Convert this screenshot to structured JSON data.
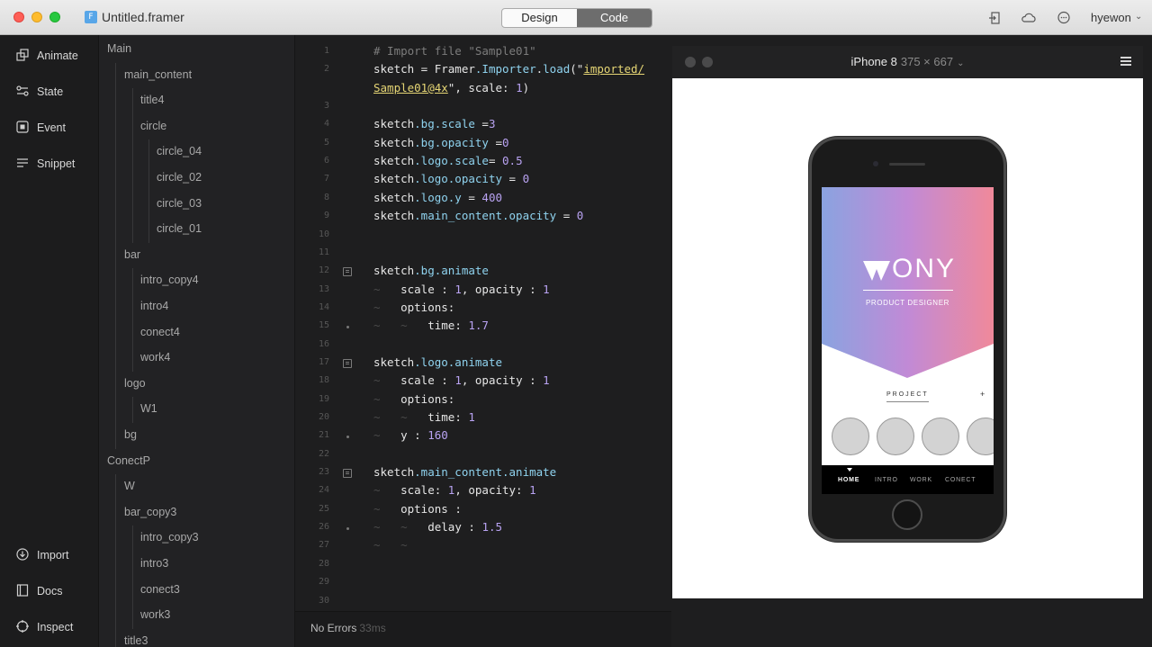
{
  "window": {
    "title": "Untitled.framer",
    "doc_icon": "F",
    "mode_tabs": [
      {
        "label": "Design",
        "active": false
      },
      {
        "label": "Code",
        "active": true
      }
    ],
    "toolbar_icons": [
      "export-icon",
      "cloud-icon",
      "chat-icon"
    ],
    "user": "hyewon"
  },
  "leftnav": {
    "top": [
      {
        "icon": "animate-icon",
        "label": "Animate"
      },
      {
        "icon": "state-icon",
        "label": "State"
      },
      {
        "icon": "event-icon",
        "label": "Event"
      },
      {
        "icon": "snippet-icon",
        "label": "Snippet"
      }
    ],
    "bottom": [
      {
        "icon": "import-icon",
        "label": "Import"
      },
      {
        "icon": "docs-icon",
        "label": "Docs"
      },
      {
        "icon": "inspect-icon",
        "label": "Inspect"
      }
    ]
  },
  "layers": [
    {
      "name": "Main",
      "depth": 0
    },
    {
      "name": "main_content",
      "depth": 1
    },
    {
      "name": "title4",
      "depth": 2
    },
    {
      "name": "circle",
      "depth": 2
    },
    {
      "name": "circle_04",
      "depth": 3
    },
    {
      "name": "circle_02",
      "depth": 3
    },
    {
      "name": "circle_03",
      "depth": 3
    },
    {
      "name": "circle_01",
      "depth": 3
    },
    {
      "name": "bar",
      "depth": 1
    },
    {
      "name": "intro_copy4",
      "depth": 2
    },
    {
      "name": "intro4",
      "depth": 2
    },
    {
      "name": "conect4",
      "depth": 2
    },
    {
      "name": "work4",
      "depth": 2
    },
    {
      "name": "logo",
      "depth": 1
    },
    {
      "name": "W1",
      "depth": 2
    },
    {
      "name": "bg",
      "depth": 1
    },
    {
      "name": "ConectP",
      "depth": 0
    },
    {
      "name": "W",
      "depth": 1
    },
    {
      "name": "bar_copy3",
      "depth": 1
    },
    {
      "name": "intro_copy3",
      "depth": 2
    },
    {
      "name": "intro3",
      "depth": 2
    },
    {
      "name": "conect3",
      "depth": 2
    },
    {
      "name": "work3",
      "depth": 2
    },
    {
      "name": "title3",
      "depth": 1
    }
  ],
  "code": {
    "line_numbers": [
      "1",
      "2",
      "",
      "3",
      "4",
      "5",
      "6",
      "7",
      "8",
      "9",
      "10",
      "11",
      "12",
      "13",
      "14",
      "15",
      "16",
      "17",
      "18",
      "19",
      "20",
      "21",
      "22",
      "23",
      "24",
      "25",
      "26",
      "27",
      "28",
      "29",
      "30"
    ],
    "lines": [
      {
        "n": "1",
        "tokens": [
          [
            "c-comment",
            "# Import file \"Sample01\""
          ]
        ]
      },
      {
        "n": "2",
        "tokens": [
          [
            "",
            "sketch = Framer"
          ],
          [
            "c-prop",
            ".Importer"
          ],
          [
            "",
            "."
          ],
          [
            "c-prop",
            "load"
          ],
          [
            "",
            "(\""
          ],
          [
            "c-str",
            "imported/"
          ]
        ]
      },
      {
        "n": "",
        "tokens": [
          [
            "c-str",
            "Sample01@4x"
          ],
          [
            "",
            "\", scale: "
          ],
          [
            "c-num",
            "1"
          ],
          [
            "",
            ")"
          ]
        ]
      },
      {
        "n": "3",
        "tokens": []
      },
      {
        "n": "4",
        "tokens": [
          [
            "",
            "sketch"
          ],
          [
            "c-prop",
            ".bg.scale"
          ],
          [
            "",
            " ="
          ],
          [
            "c-num",
            "3"
          ]
        ]
      },
      {
        "n": "5",
        "tokens": [
          [
            "",
            "sketch"
          ],
          [
            "c-prop",
            ".bg.opacity"
          ],
          [
            "",
            " ="
          ],
          [
            "c-num",
            "0"
          ]
        ]
      },
      {
        "n": "6",
        "tokens": [
          [
            "",
            "sketch"
          ],
          [
            "c-prop",
            ".logo.scale"
          ],
          [
            "",
            "= "
          ],
          [
            "c-num",
            "0.5"
          ]
        ]
      },
      {
        "n": "7",
        "tokens": [
          [
            "",
            "sketch"
          ],
          [
            "c-prop",
            ".logo.opacity"
          ],
          [
            "",
            " = "
          ],
          [
            "c-num",
            "0"
          ]
        ]
      },
      {
        "n": "8",
        "tokens": [
          [
            "",
            "sketch"
          ],
          [
            "c-prop",
            ".logo.y"
          ],
          [
            "",
            " = "
          ],
          [
            "c-num",
            "400"
          ]
        ]
      },
      {
        "n": "9",
        "tokens": [
          [
            "",
            "sketch"
          ],
          [
            "c-prop",
            ".main_content.opacity"
          ],
          [
            "",
            " = "
          ],
          [
            "c-num",
            "0"
          ]
        ]
      },
      {
        "n": "10",
        "tokens": []
      },
      {
        "n": "11",
        "tokens": []
      },
      {
        "n": "12",
        "tokens": [
          [
            "",
            "sketch"
          ],
          [
            "c-prop",
            ".bg.animate"
          ]
        ]
      },
      {
        "n": "13",
        "tokens": [
          [
            "c-tilde",
            "~   "
          ],
          [
            "",
            "scale : "
          ],
          [
            "c-num",
            "1"
          ],
          [
            "",
            ", opacity : "
          ],
          [
            "c-num",
            "1"
          ]
        ]
      },
      {
        "n": "14",
        "tokens": [
          [
            "c-tilde",
            "~   "
          ],
          [
            "",
            "options:"
          ]
        ]
      },
      {
        "n": "15",
        "tokens": [
          [
            "c-tilde",
            "~   ~   "
          ],
          [
            "",
            "time: "
          ],
          [
            "c-num",
            "1.7"
          ]
        ]
      },
      {
        "n": "16",
        "tokens": []
      },
      {
        "n": "17",
        "tokens": [
          [
            "",
            "sketch"
          ],
          [
            "c-prop",
            ".logo.animate"
          ]
        ]
      },
      {
        "n": "18",
        "tokens": [
          [
            "c-tilde",
            "~   "
          ],
          [
            "",
            "scale : "
          ],
          [
            "c-num",
            "1"
          ],
          [
            "",
            ", opacity : "
          ],
          [
            "c-num",
            "1"
          ]
        ]
      },
      {
        "n": "19",
        "tokens": [
          [
            "c-tilde",
            "~   "
          ],
          [
            "",
            "options:"
          ]
        ]
      },
      {
        "n": "20",
        "tokens": [
          [
            "c-tilde",
            "~   ~   "
          ],
          [
            "",
            "time: "
          ],
          [
            "c-num",
            "1"
          ]
        ]
      },
      {
        "n": "21",
        "tokens": [
          [
            "c-tilde",
            "~   "
          ],
          [
            "",
            "y : "
          ],
          [
            "c-num",
            "160"
          ]
        ]
      },
      {
        "n": "22",
        "tokens": []
      },
      {
        "n": "23",
        "tokens": [
          [
            "",
            "sketch"
          ],
          [
            "c-prop",
            ".main_content.animate"
          ]
        ]
      },
      {
        "n": "24",
        "tokens": [
          [
            "c-tilde",
            "~   "
          ],
          [
            "",
            "scale: "
          ],
          [
            "c-num",
            "1"
          ],
          [
            "",
            ", opacity: "
          ],
          [
            "c-num",
            "1"
          ]
        ]
      },
      {
        "n": "25",
        "tokens": [
          [
            "c-tilde",
            "~   "
          ],
          [
            "",
            "options :"
          ]
        ]
      },
      {
        "n": "26",
        "tokens": [
          [
            "c-tilde",
            "~   ~   "
          ],
          [
            "",
            "delay : "
          ],
          [
            "c-num",
            "1.5"
          ]
        ]
      },
      {
        "n": "27",
        "tokens": [
          [
            "c-tilde",
            "~   ~"
          ]
        ]
      },
      {
        "n": "28",
        "tokens": []
      },
      {
        "n": "29",
        "tokens": []
      },
      {
        "n": "30",
        "tokens": []
      }
    ],
    "fold_lines": [
      "12",
      "17",
      "23"
    ],
    "dot_lines": [
      "15",
      "21",
      "26"
    ]
  },
  "status": {
    "text": "No Errors",
    "time": "33ms"
  },
  "preview": {
    "device": "iPhone 8",
    "size": "375 × 667",
    "menu_icon": "hamburger-icon"
  },
  "phone_app": {
    "logo": "ONY",
    "subtitle": "PRODUCT DESIGNER",
    "section": "PROJECT",
    "plus": "+",
    "tabs": [
      "HOME",
      "INTRO",
      "WORK",
      "CONECT"
    ],
    "active_tab": "HOME",
    "gradient_colors": [
      "#8aa3e0",
      "#c18ad6",
      "#f0899a"
    ]
  }
}
